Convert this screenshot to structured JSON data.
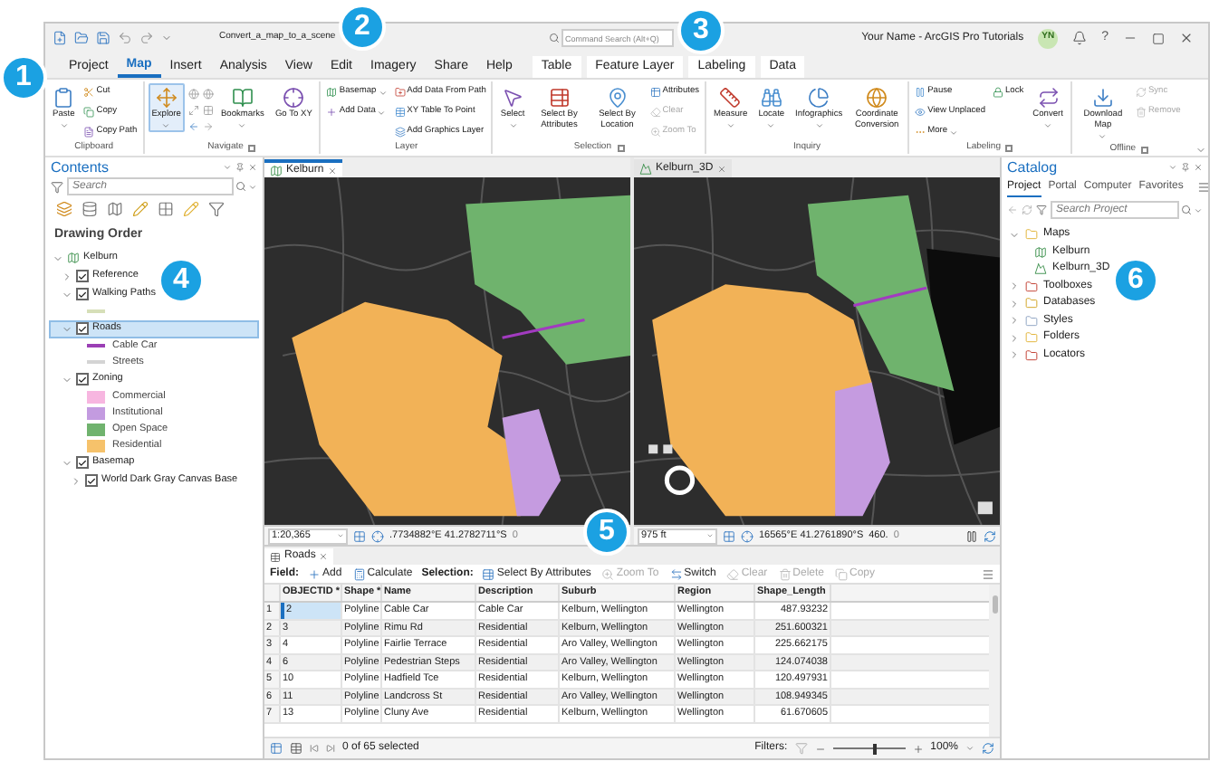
{
  "title_bar": {
    "title": "Convert_a_map_to_a_scene",
    "search": {
      "placeholder": "Command Search (Alt+Q)"
    },
    "user": "Your Name - ArcGIS Pro Tutorials",
    "avatar": "YN",
    "help": "?"
  },
  "ribbon_tabs": [
    {
      "label": "Project",
      "selected": false,
      "kind": "main"
    },
    {
      "label": "Map",
      "selected": true,
      "kind": "main"
    },
    {
      "label": "Insert",
      "selected": false,
      "kind": "main"
    },
    {
      "label": "Analysis",
      "selected": false,
      "kind": "main"
    },
    {
      "label": "View",
      "selected": false,
      "kind": "main"
    },
    {
      "label": "Edit",
      "selected": false,
      "kind": "main"
    },
    {
      "label": "Imagery",
      "selected": false,
      "kind": "main"
    },
    {
      "label": "Share",
      "selected": false,
      "kind": "main"
    },
    {
      "label": "Help",
      "selected": false,
      "kind": "main"
    },
    {
      "label": "Table",
      "selected": false,
      "kind": "contextual"
    },
    {
      "label": "Feature Layer",
      "selected": false,
      "kind": "contextual"
    },
    {
      "label": "Labeling",
      "selected": false,
      "kind": "contextual"
    },
    {
      "label": "Data",
      "selected": false,
      "kind": "contextual"
    }
  ],
  "ribbon_groups": [
    {
      "name": "Clipboard",
      "launcher": false,
      "columns": [
        [
          {
            "label": "Paste",
            "kind": "large",
            "disabled": false,
            "active": false,
            "menu": true
          }
        ],
        [
          {
            "label": "Cut",
            "kind": "small",
            "disabled": false,
            "active": false,
            "menu": false
          },
          {
            "label": "Copy",
            "kind": "small",
            "disabled": false,
            "active": false,
            "menu": false
          },
          {
            "label": "Copy Path",
            "kind": "small",
            "disabled": false,
            "active": false,
            "menu": false
          }
        ]
      ]
    },
    {
      "name": "Navigate",
      "launcher": true,
      "columns": [
        [
          {
            "label": "Explore",
            "kind": "large",
            "disabled": false,
            "active": true,
            "menu": true
          }
        ],
        [
          {
            "label": "Bookmarks",
            "kind": "large",
            "disabled": false,
            "active": false,
            "menu": true
          }
        ],
        [
          {
            "label": "Go To XY",
            "kind": "large",
            "disabled": false,
            "active": false,
            "menu": false
          }
        ]
      ]
    },
    {
      "name": "Layer",
      "launcher": false,
      "columns": [
        [
          {
            "label": "Basemap",
            "kind": "small",
            "disabled": false,
            "active": false,
            "menu": true
          },
          {
            "label": "Add Data",
            "kind": "small",
            "disabled": false,
            "active": false,
            "menu": true
          }
        ],
        [
          {
            "label": "Add Data From Path",
            "kind": "small",
            "disabled": false,
            "active": false,
            "menu": false
          },
          {
            "label": "XY Table To Point",
            "kind": "small",
            "disabled": false,
            "active": false,
            "menu": false
          },
          {
            "label": "Add Graphics Layer",
            "kind": "small",
            "disabled": false,
            "active": false,
            "menu": false
          }
        ]
      ]
    },
    {
      "name": "Selection",
      "launcher": true,
      "columns": [
        [
          {
            "label": "Select",
            "kind": "large",
            "disabled": false,
            "active": false,
            "menu": true
          }
        ],
        [
          {
            "label": "Select By Attributes",
            "kind": "large",
            "disabled": false,
            "active": false,
            "menu": false
          }
        ],
        [
          {
            "label": "Select By Location",
            "kind": "large",
            "disabled": false,
            "active": false,
            "menu": false
          }
        ],
        [
          {
            "label": "Attributes",
            "kind": "small",
            "disabled": false,
            "active": false,
            "menu": false
          },
          {
            "label": "Clear",
            "kind": "small",
            "disabled": true,
            "active": false,
            "menu": false
          },
          {
            "label": "Zoom To",
            "kind": "small",
            "disabled": true,
            "active": false,
            "menu": false
          }
        ]
      ]
    },
    {
      "name": "Inquiry",
      "launcher": false,
      "columns": [
        [
          {
            "label": "Measure",
            "kind": "large",
            "disabled": false,
            "active": false,
            "menu": true
          }
        ],
        [
          {
            "label": "Locate",
            "kind": "large",
            "disabled": false,
            "active": false,
            "menu": true
          }
        ],
        [
          {
            "label": "Infographics",
            "kind": "large",
            "disabled": false,
            "active": false,
            "menu": true
          }
        ],
        [
          {
            "label": "Coordinate Conversion",
            "kind": "large",
            "disabled": false,
            "active": false,
            "menu": false
          }
        ]
      ]
    },
    {
      "name": "Labeling",
      "launcher": true,
      "columns": [
        [
          {
            "label": "Pause",
            "kind": "small",
            "disabled": false,
            "active": false,
            "menu": false
          },
          {
            "label": "View Unplaced",
            "kind": "small",
            "disabled": false,
            "active": false,
            "menu": false
          },
          {
            "label": "More",
            "kind": "small",
            "disabled": false,
            "active": false,
            "menu": true
          }
        ],
        [
          {
            "label": "Lock",
            "kind": "small",
            "disabled": false,
            "active": false,
            "menu": false
          }
        ],
        [
          {
            "label": "Convert",
            "kind": "large",
            "disabled": false,
            "active": false,
            "menu": true
          }
        ]
      ]
    },
    {
      "name": "Offline",
      "launcher": true,
      "columns": [
        [
          {
            "label": "Download Map",
            "kind": "large",
            "disabled": false,
            "active": false,
            "menu": true
          }
        ],
        [
          {
            "label": "Sync",
            "kind": "small",
            "disabled": true,
            "active": false,
            "menu": false
          },
          {
            "label": "Remove",
            "kind": "small",
            "disabled": true,
            "active": false,
            "menu": false
          }
        ]
      ]
    }
  ],
  "contents": {
    "title": "Contents",
    "search": {
      "placeholder": "Search"
    },
    "heading": "Drawing Order",
    "tree": [
      {
        "label": "Kelburn",
        "kind": "map",
        "expanded": true,
        "selected": false,
        "children": [
          {
            "label": "Reference",
            "kind": "layer",
            "checked": true,
            "expanded": false,
            "selected": false
          },
          {
            "label": "Walking Paths",
            "kind": "layer",
            "checked": true,
            "expanded": true,
            "selected": false,
            "legend": [
              {
                "kind": "line",
                "color": "#d6dfb8"
              }
            ]
          },
          {
            "label": "Roads",
            "kind": "layer",
            "checked": true,
            "expanded": true,
            "selected": true,
            "legend": [
              {
                "label": "Cable Car",
                "kind": "line",
                "color": "#9b3fb5"
              },
              {
                "label": "Streets",
                "kind": "line",
                "color": "#d4d4d4"
              }
            ]
          },
          {
            "label": "Zoning",
            "kind": "layer",
            "checked": true,
            "expanded": true,
            "selected": false,
            "legend": [
              {
                "label": "Commercial",
                "kind": "patch",
                "color": "#f7b6e0"
              },
              {
                "label": "Institutional",
                "kind": "patch",
                "color": "#c39be0"
              },
              {
                "label": "Open Space",
                "kind": "patch",
                "color": "#70b36e"
              },
              {
                "label": "Residential",
                "kind": "patch",
                "color": "#f6c26b"
              }
            ]
          },
          {
            "label": "Basemap",
            "kind": "layer",
            "checked": true,
            "expanded": true,
            "selected": false,
            "children": [
              {
                "label": "World Dark Gray Canvas Base",
                "kind": "layer",
                "checked": true,
                "expanded": false,
                "selected": false
              }
            ]
          }
        ]
      }
    ]
  },
  "map_views": [
    {
      "title": "Kelburn",
      "kind": "map",
      "selected": true,
      "scale": "1:20,365",
      "coordinates": ".7734882°E 41.2782711°S",
      "selection_count": "0"
    },
    {
      "title": "Kelburn_3D",
      "kind": "scene",
      "selected": false,
      "scale": "975 ft",
      "coordinates": "16565°E 41.2761890°S",
      "elevation": "460.",
      "selection_count": "0"
    }
  ],
  "table": {
    "title": "Roads",
    "toolbar": [
      {
        "label": "Field:",
        "kind": "label"
      },
      {
        "label": "Add",
        "kind": "button",
        "disabled": false
      },
      {
        "label": "Calculate",
        "kind": "button",
        "disabled": false
      },
      {
        "label": "Selection:",
        "kind": "label"
      },
      {
        "label": "Select By Attributes",
        "kind": "button",
        "disabled": false
      },
      {
        "label": "Zoom To",
        "kind": "button",
        "disabled": true
      },
      {
        "label": "Switch",
        "kind": "button",
        "disabled": false
      },
      {
        "label": "Clear",
        "kind": "button",
        "disabled": true
      },
      {
        "label": "Delete",
        "kind": "button",
        "disabled": true
      },
      {
        "label": "Copy",
        "kind": "button",
        "disabled": true
      }
    ],
    "columns": [
      "OBJECTID *",
      "Shape *",
      "Name",
      "Description",
      "Suburb",
      "Region",
      "Shape_Length"
    ],
    "rows": [
      {
        "number": "1",
        "selected": true,
        "cells": [
          "2",
          "Polyline",
          "Cable Car",
          "Cable Car",
          "Kelburn, Wellington",
          "Wellington",
          "487.93232"
        ]
      },
      {
        "number": "2",
        "selected": false,
        "cells": [
          "3",
          "Polyline",
          "Rimu Rd",
          "Residential",
          "Kelburn, Wellington",
          "Wellington",
          "251.600321"
        ]
      },
      {
        "number": "3",
        "selected": false,
        "cells": [
          "4",
          "Polyline",
          "Fairlie Terrace",
          "Residential",
          "Aro Valley, Wellington",
          "Wellington",
          "225.662175"
        ]
      },
      {
        "number": "4",
        "selected": false,
        "cells": [
          "6",
          "Polyline",
          "Pedestrian Steps",
          "Residential",
          "Aro Valley, Wellington",
          "Wellington",
          "124.074038"
        ]
      },
      {
        "number": "5",
        "selected": false,
        "cells": [
          "10",
          "Polyline",
          "Hadfield Tce",
          "Residential",
          "Kelburn, Wellington",
          "Wellington",
          "120.497931"
        ]
      },
      {
        "number": "6",
        "selected": false,
        "cells": [
          "11",
          "Polyline",
          "Landcross St",
          "Residential",
          "Aro Valley, Wellington",
          "Wellington",
          "108.949345"
        ]
      },
      {
        "number": "7",
        "selected": false,
        "cells": [
          "13",
          "Polyline",
          "Cluny Ave",
          "Residential",
          "Kelburn, Wellington",
          "Wellington",
          "61.670605"
        ]
      }
    ],
    "footer": {
      "status": "0 of 65 selected",
      "filters": "Filters:",
      "zoom": {
        "level": 0.55
      },
      "zoom_text": "100%"
    }
  },
  "catalog": {
    "title": "Catalog",
    "tabs": [
      {
        "label": "Project",
        "selected": true
      },
      {
        "label": "Portal",
        "selected": false
      },
      {
        "label": "Computer",
        "selected": false
      },
      {
        "label": "Favorites",
        "selected": false
      }
    ],
    "search": {
      "placeholder": "Search Project"
    },
    "tree": [
      {
        "label": "Maps",
        "expanded": true,
        "children": [
          {
            "label": "Kelburn",
            "kind": "map"
          },
          {
            "label": "Kelburn_3D",
            "kind": "scene"
          }
        ]
      },
      {
        "label": "Toolboxes",
        "expanded": false
      },
      {
        "label": "Databases",
        "expanded": false
      },
      {
        "label": "Styles",
        "expanded": false
      },
      {
        "label": "Folders",
        "expanded": false
      },
      {
        "label": "Locators",
        "expanded": false
      }
    ]
  },
  "callouts": [
    "1",
    "2",
    "3",
    "4",
    "5",
    "6"
  ]
}
